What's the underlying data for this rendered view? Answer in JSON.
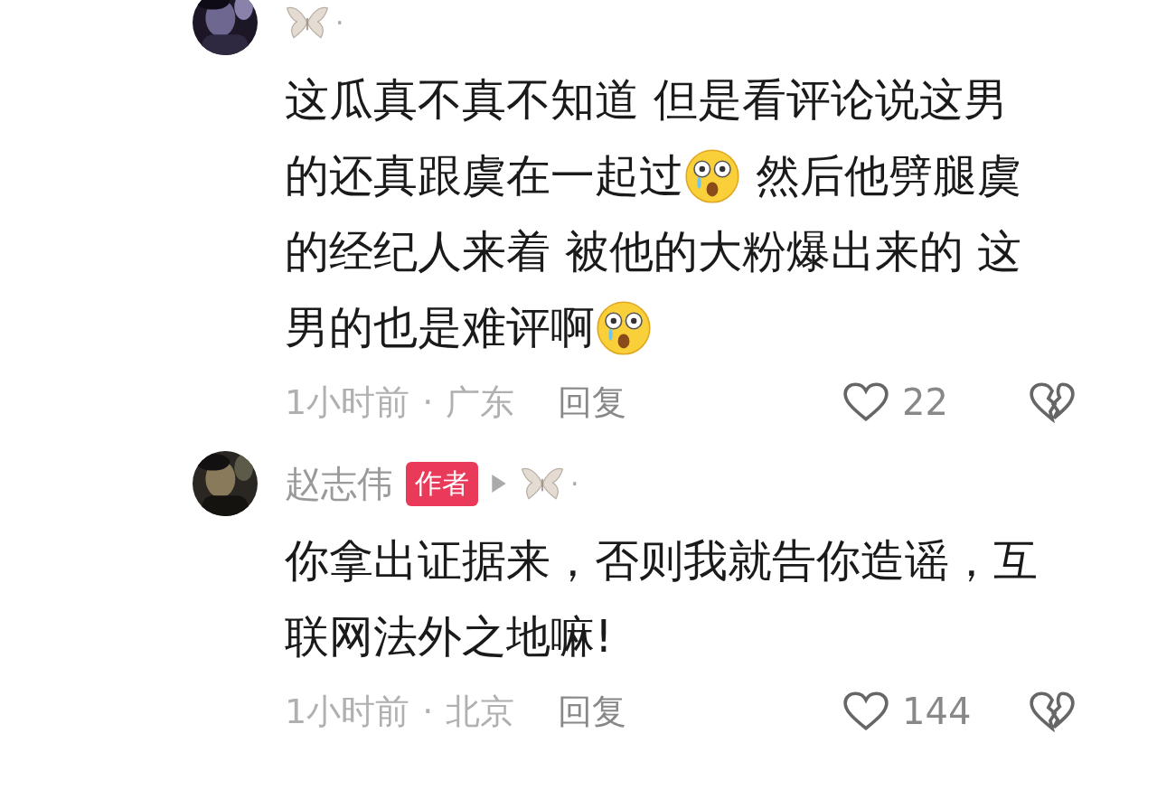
{
  "comments": [
    {
      "mark": "·",
      "lines": [
        [
          {
            "kind": "text",
            "text": "这瓜真不真不知道 但是看评论说这男"
          }
        ],
        [
          {
            "kind": "text",
            "text": "的还真跟虞在一起过"
          },
          {
            "kind": "emoji"
          },
          {
            "kind": "text",
            "text": " 然后他劈腿虞"
          }
        ],
        [
          {
            "kind": "text",
            "text": "的经纪人来着 被他的大粉爆出来的 这"
          }
        ],
        [
          {
            "kind": "text",
            "text": "男的也是难评啊"
          },
          {
            "kind": "emoji"
          }
        ]
      ],
      "time": "1小时前",
      "separator": "·",
      "location": "广东",
      "reply": "回复",
      "likes": "22"
    },
    {
      "author": "赵志伟",
      "badge": "作者",
      "reply_to": true,
      "mark": "·",
      "lines": [
        [
          {
            "kind": "text",
            "text": "你拿出证据来，否则我就告你造谣，互"
          }
        ],
        [
          {
            "kind": "text",
            "text": "联网法外之地嘛!"
          }
        ]
      ],
      "time": "1小时前",
      "separator": "·",
      "location": "北京",
      "reply": "回复",
      "likes": "144"
    }
  ]
}
